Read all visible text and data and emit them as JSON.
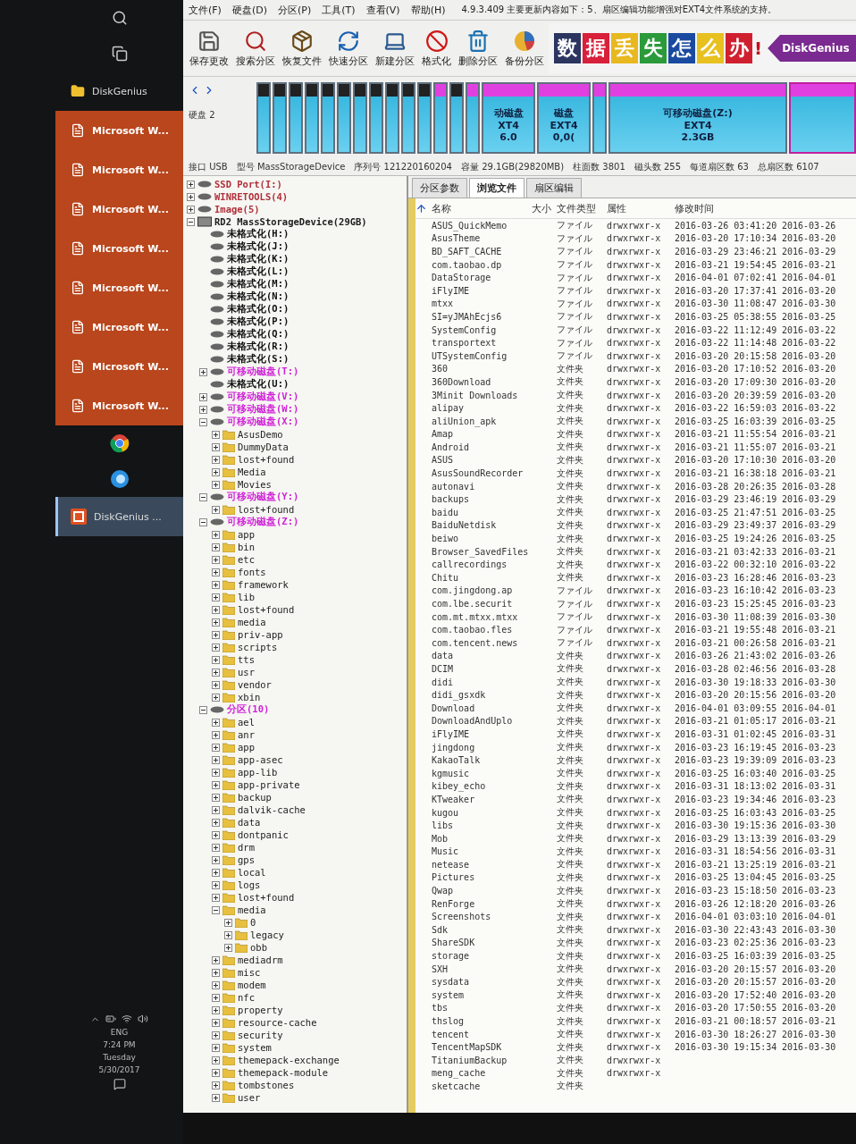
{
  "taskbar": {
    "items": [
      {
        "kind": "search",
        "selected": false
      },
      {
        "kind": "taskview",
        "selected": false
      },
      {
        "kind": "folder",
        "label": "DiskGenius",
        "selected": false,
        "attention": false
      },
      {
        "kind": "word",
        "label": "Microsoft W...",
        "selected": false,
        "attention": true
      },
      {
        "kind": "word",
        "label": "Microsoft W...",
        "selected": false,
        "attention": true
      },
      {
        "kind": "word",
        "label": "Microsoft W...",
        "selected": false,
        "attention": true
      },
      {
        "kind": "word",
        "label": "Microsoft W...",
        "selected": false,
        "attention": true
      },
      {
        "kind": "word",
        "label": "Microsoft W...",
        "selected": false,
        "attention": true
      },
      {
        "kind": "word",
        "label": "Microsoft W...",
        "selected": false,
        "attention": true
      },
      {
        "kind": "word",
        "label": "Microsoft W...",
        "selected": false,
        "attention": true
      },
      {
        "kind": "word",
        "label": "Microsoft W...",
        "selected": false,
        "attention": true
      },
      {
        "kind": "chrome",
        "selected": false,
        "attention": false
      },
      {
        "kind": "browser",
        "selected": false,
        "attention": false
      },
      {
        "kind": "diskgenius",
        "label": "DiskGenius ...",
        "selected": true,
        "attention": false
      }
    ],
    "tray": {
      "language": "ENG",
      "time": "7:24 PM",
      "day": "Tuesday",
      "date": "5/30/2017"
    }
  },
  "menu": {
    "items": [
      "文件(F)",
      "硬盘(D)",
      "分区(P)",
      "工具(T)",
      "查看(V)",
      "帮助(H)"
    ],
    "notice": "4.9.3.409 主要更新内容如下：5、扇区编辑功能增强对EXT4文件系统的支持。"
  },
  "toolbar": [
    {
      "kind": "save",
      "label": "保存更改"
    },
    {
      "kind": "search",
      "label": "搜索分区"
    },
    {
      "kind": "recover",
      "label": "恢复文件"
    },
    {
      "kind": "quick",
      "label": "快速分区"
    },
    {
      "kind": "new",
      "label": "新建分区"
    },
    {
      "kind": "format",
      "label": "格式化"
    },
    {
      "kind": "delete",
      "label": "删除分区"
    },
    {
      "kind": "backup",
      "label": "备份分区"
    }
  ],
  "banner": {
    "tiles": [
      {
        "text": "数",
        "color": "#2b3560"
      },
      {
        "text": "据",
        "color": "#d8203a"
      },
      {
        "text": "丢",
        "color": "#e8b820"
      },
      {
        "text": "失",
        "color": "#2a9a3a"
      },
      {
        "text": "怎",
        "color": "#1a4aa0"
      },
      {
        "text": "么",
        "color": "#e8c020"
      },
      {
        "text": "办",
        "color": "#d02030"
      }
    ],
    "mark": "!",
    "brand": "DiskGenius"
  },
  "disk": {
    "label": "硬盘 2",
    "blocks": [
      {
        "kind": "unformatted",
        "selected": false
      },
      {
        "kind": "unformatted",
        "selected": false
      },
      {
        "kind": "unformatted",
        "selected": false
      },
      {
        "kind": "unformatted",
        "selected": false
      },
      {
        "kind": "unformatted",
        "selected": false
      },
      {
        "kind": "unformatted",
        "selected": false
      },
      {
        "kind": "unformatted",
        "selected": false
      },
      {
        "kind": "unformatted",
        "selected": false
      },
      {
        "kind": "unformatted",
        "selected": false
      },
      {
        "kind": "unformatted",
        "selected": false
      },
      {
        "kind": "unformatted",
        "selected": false
      },
      {
        "kind": "removable",
        "selected": false
      },
      {
        "kind": "unformatted",
        "selected": false
      },
      {
        "kind": "removable",
        "selected": false
      },
      {
        "kind": "removable",
        "selected": false,
        "lines": [
          "动磁盘",
          "XT4",
          "6.0"
        ]
      },
      {
        "kind": "removable",
        "selected": false,
        "lines": [
          "磁盘",
          "EXT4",
          "0,0("
        ]
      },
      {
        "kind": "removable",
        "selected": false
      },
      {
        "kind": "removable",
        "selected": false,
        "lines": [
          "可移动磁盘(Z:)",
          "EXT4",
          "2.3GB"
        ]
      },
      {
        "kind": "removable",
        "selected": true
      }
    ]
  },
  "info": [
    {
      "label": "接口",
      "value": "USB"
    },
    {
      "label": "型号",
      "value": "MassStorageDevice"
    },
    {
      "label": "序列号",
      "value": "121220160204"
    },
    {
      "label": "容量",
      "value": "29.1GB(29820MB)"
    },
    {
      "label": "柱面数",
      "value": "3801"
    },
    {
      "label": "磁头数",
      "value": "255"
    },
    {
      "label": "每道扇区数",
      "value": "63"
    },
    {
      "label": "总扇区数",
      "value": "6107"
    }
  ],
  "tree": [
    {
      "label": "SSD Port(I:)",
      "kind": "partition",
      "color": "#b0303a",
      "expanded": false
    },
    {
      "label": "WINRETOOLS(4)",
      "kind": "partition",
      "color": "#b0303a",
      "expanded": false
    },
    {
      "label": "Image(5)",
      "kind": "partition",
      "color": "#b0303a",
      "expanded": false
    },
    {
      "label": "RD2 MassStorageDevice(29GB)",
      "kind": "disk",
      "color": "#202020",
      "expanded": true,
      "children": [
        {
          "label": "未格式化(H:)",
          "kind": "partition",
          "color": "#101010"
        },
        {
          "label": "未格式化(J:)",
          "kind": "partition",
          "color": "#101010"
        },
        {
          "label": "未格式化(K:)",
          "kind": "partition",
          "color": "#101010"
        },
        {
          "label": "未格式化(L:)",
          "kind": "partition",
          "color": "#101010"
        },
        {
          "label": "未格式化(M:)",
          "kind": "partition",
          "color": "#101010"
        },
        {
          "label": "未格式化(N:)",
          "kind": "partition",
          "color": "#101010"
        },
        {
          "label": "未格式化(O:)",
          "kind": "partition",
          "color": "#101010"
        },
        {
          "label": "未格式化(P:)",
          "kind": "partition",
          "color": "#101010"
        },
        {
          "label": "未格式化(Q:)",
          "kind": "partition",
          "color": "#101010"
        },
        {
          "label": "未格式化(R:)",
          "kind": "partition",
          "color": "#101010"
        },
        {
          "label": "未格式化(S:)",
          "kind": "partition",
          "color": "#101010"
        },
        {
          "label": "可移动磁盘(T:)",
          "kind": "partition",
          "color": "#d020d8",
          "expanded": false
        },
        {
          "label": "未格式化(U:)",
          "kind": "partition",
          "color": "#101010"
        },
        {
          "label": "可移动磁盘(V:)",
          "kind": "partition",
          "color": "#d020d8",
          "expanded": false
        },
        {
          "label": "可移动磁盘(W:)",
          "kind": "partition",
          "color": "#d020d8",
          "expanded": false
        },
        {
          "label": "可移动磁盘(X:)",
          "kind": "partition",
          "color": "#d020d8",
          "expanded": true,
          "children": [
            {
              "label": "AsusDemo",
              "kind": "folder",
              "expanded": false
            },
            {
              "label": "DummyData",
              "kind": "folder",
              "expanded": false
            },
            {
              "label": "lost+found",
              "kind": "folder",
              "expanded": false
            },
            {
              "label": "Media",
              "kind": "folder",
              "expanded": false
            },
            {
              "label": "Movies",
              "kind": "folder",
              "expanded": false
            }
          ]
        },
        {
          "label": "可移动磁盘(Y:)",
          "kind": "partition",
          "color": "#d020d8",
          "expanded": true,
          "children": [
            {
              "label": "lost+found",
              "kind": "folder",
              "expanded": false
            }
          ]
        },
        {
          "label": "可移动磁盘(Z:)",
          "kind": "partition",
          "color": "#d020d8",
          "expanded": true,
          "children": [
            {
              "label": "app",
              "kind": "folder",
              "expanded": false
            },
            {
              "label": "bin",
              "kind": "folder",
              "expanded": false
            },
            {
              "label": "etc",
              "kind": "folder",
              "expanded": false
            },
            {
              "label": "fonts",
              "kind": "folder",
              "expanded": false
            },
            {
              "label": "framework",
              "kind": "folder",
              "expanded": false
            },
            {
              "label": "lib",
              "kind": "folder",
              "expanded": false
            },
            {
              "label": "lost+found",
              "kind": "folder",
              "expanded": false
            },
            {
              "label": "media",
              "kind": "folder",
              "expanded": false
            },
            {
              "label": "priv-app",
              "kind": "folder",
              "expanded": false
            },
            {
              "label": "scripts",
              "kind": "folder",
              "expanded": false
            },
            {
              "label": "tts",
              "kind": "folder",
              "expanded": false
            },
            {
              "label": "usr",
              "kind": "folder",
              "expanded": false
            },
            {
              "label": "vendor",
              "kind": "folder",
              "expanded": false
            },
            {
              "label": "xbin",
              "kind": "folder",
              "expanded": false
            }
          ]
        },
        {
          "label": "分区(10)",
          "kind": "partition",
          "color": "#d020d8",
          "expanded": true,
          "children": [
            {
              "label": "ael",
              "kind": "folder",
              "expanded": false
            },
            {
              "label": "anr",
              "kind": "folder",
              "expanded": false
            },
            {
              "label": "app",
              "kind": "folder",
              "expanded": false
            },
            {
              "label": "app-asec",
              "kind": "folder",
              "expanded": false
            },
            {
              "label": "app-lib",
              "kind": "folder",
              "expanded": false
            },
            {
              "label": "app-private",
              "kind": "folder",
              "expanded": false
            },
            {
              "label": "backup",
              "kind": "folder",
              "expanded": false
            },
            {
              "label": "dalvik-cache",
              "kind": "folder",
              "expanded": false
            },
            {
              "label": "data",
              "kind": "folder",
              "expanded": false
            },
            {
              "label": "dontpanic",
              "kind": "folder",
              "expanded": false
            },
            {
              "label": "drm",
              "kind": "folder",
              "expanded": false
            },
            {
              "label": "gps",
              "kind": "folder",
              "expanded": false
            },
            {
              "label": "local",
              "kind": "folder",
              "expanded": false
            },
            {
              "label": "logs",
              "kind": "folder",
              "expanded": false
            },
            {
              "label": "lost+found",
              "kind": "folder",
              "expanded": false
            },
            {
              "label": "media",
              "kind": "folder",
              "expanded": true,
              "children": [
                {
                  "label": "0",
                  "kind": "folder",
                  "expanded": false
                },
                {
                  "label": "legacy",
                  "kind": "folder",
                  "expanded": false
                },
                {
                  "label": "obb",
                  "kind": "folder",
                  "expanded": false
                }
              ]
            },
            {
              "label": "mediadrm",
              "kind": "folder",
              "expanded": false
            },
            {
              "label": "misc",
              "kind": "folder",
              "expanded": false
            },
            {
              "label": "modem",
              "kind": "folder",
              "expanded": false
            },
            {
              "label": "nfc",
              "kind": "folder",
              "expanded": false
            },
            {
              "label": "property",
              "kind": "folder",
              "expanded": false
            },
            {
              "label": "resource-cache",
              "kind": "folder",
              "expanded": false
            },
            {
              "label": "security",
              "kind": "folder",
              "expanded": false
            },
            {
              "label": "system",
              "kind": "folder",
              "expanded": false
            },
            {
              "label": "themepack-exchange",
              "kind": "folder",
              "expanded": false
            },
            {
              "label": "themepack-module",
              "kind": "folder",
              "expanded": false
            },
            {
              "label": "tombstones",
              "kind": "folder",
              "expanded": false
            },
            {
              "label": "user",
              "kind": "folder",
              "expanded": false
            }
          ]
        }
      ]
    }
  ],
  "tabs": [
    {
      "label": "分区参数",
      "selected": false
    },
    {
      "label": "浏览文件",
      "selected": true
    },
    {
      "label": "扇区编辑",
      "selected": false
    }
  ],
  "files": {
    "header": {
      "name": "名称",
      "size": "大小",
      "type": "文件类型",
      "attributes": "属性",
      "modified": "修改时间"
    },
    "rows": [
      {
        "name": "ASUS_QuickMemo",
        "type": "ファイル",
        "attributes": "drwxrwxr-x",
        "modified": "2016-03-26 03:41:20",
        "column_6": "2016-03-26"
      },
      {
        "name": "AsusTheme",
        "type": "ファイル",
        "attributes": "drwxrwxr-x",
        "modified": "2016-03-20 17:10:34",
        "column_6": "2016-03-20"
      },
      {
        "name": "BD_SAFT_CACHE",
        "type": "ファイル",
        "attributes": "drwxrwxr-x",
        "modified": "2016-03-29 23:46:21",
        "column_6": "2016-03-29"
      },
      {
        "name": "com.taobao.dp",
        "type": "ファイル",
        "attributes": "drwxrwxr-x",
        "modified": "2016-03-21 19:54:45",
        "column_6": "2016-03-21"
      },
      {
        "name": "DataStorage",
        "type": "ファイル",
        "attributes": "drwxrwxr-x",
        "modified": "2016-04-01 07:02:41",
        "column_6": "2016-04-01"
      },
      {
        "name": "iFlyIME",
        "type": "ファイル",
        "attributes": "drwxrwxr-x",
        "modified": "2016-03-20 17:37:41",
        "column_6": "2016-03-20"
      },
      {
        "name": "mtxx",
        "type": "ファイル",
        "attributes": "drwxrwxr-x",
        "modified": "2016-03-30 11:08:47",
        "column_6": "2016-03-30"
      },
      {
        "name": "SI=yJMAhEcjs6",
        "type": "ファイル",
        "attributes": "drwxrwxr-x",
        "modified": "2016-03-25 05:38:55",
        "column_6": "2016-03-25"
      },
      {
        "name": "SystemConfig",
        "type": "ファイル",
        "attributes": "drwxrwxr-x",
        "modified": "2016-03-22 11:12:49",
        "column_6": "2016-03-22"
      },
      {
        "name": "transportext",
        "type": "ファイル",
        "attributes": "drwxrwxr-x",
        "modified": "2016-03-22 11:14:48",
        "column_6": "2016-03-22"
      },
      {
        "name": "UTSystemConfig",
        "type": "ファイル",
        "attributes": "drwxrwxr-x",
        "modified": "2016-03-20 20:15:58",
        "column_6": "2016-03-20"
      },
      {
        "name": "360",
        "type": "文件夹",
        "attributes": "drwxrwxr-x",
        "modified": "2016-03-20 17:10:52",
        "column_6": "2016-03-20"
      },
      {
        "name": "360Download",
        "type": "文件夹",
        "attributes": "drwxrwxr-x",
        "modified": "2016-03-20 17:09:30",
        "column_6": "2016-03-20"
      },
      {
        "name": "3Minit Downloads",
        "type": "文件夹",
        "attributes": "drwxrwxr-x",
        "modified": "2016-03-20 20:39:59",
        "column_6": "2016-03-20"
      },
      {
        "name": "alipay",
        "type": "文件夹",
        "attributes": "drwxrwxr-x",
        "modified": "2016-03-22 16:59:03",
        "column_6": "2016-03-22"
      },
      {
        "name": "aliUnion_apk",
        "type": "文件夹",
        "attributes": "drwxrwxr-x",
        "modified": "2016-03-25 16:03:39",
        "column_6": "2016-03-25"
      },
      {
        "name": "Amap",
        "type": "文件夹",
        "attributes": "drwxrwxr-x",
        "modified": "2016-03-21 11:55:54",
        "column_6": "2016-03-21"
      },
      {
        "name": "Android",
        "type": "文件夹",
        "attributes": "drwxrwxr-x",
        "modified": "2016-03-21 11:55:07",
        "column_6": "2016-03-21"
      },
      {
        "name": "ASUS",
        "type": "文件夹",
        "attributes": "drwxrwxr-x",
        "modified": "2016-03-20 17:10:30",
        "column_6": "2016-03-20"
      },
      {
        "name": "AsusSoundRecorder",
        "type": "文件夹",
        "attributes": "drwxrwxr-x",
        "modified": "2016-03-21 16:38:18",
        "column_6": "2016-03-21"
      },
      {
        "name": "autonavi",
        "type": "文件夹",
        "attributes": "drwxrwxr-x",
        "modified": "2016-03-28 20:26:35",
        "column_6": "2016-03-28"
      },
      {
        "name": "backups",
        "type": "文件夹",
        "attributes": "drwxrwxr-x",
        "modified": "2016-03-29 23:46:19",
        "column_6": "2016-03-29"
      },
      {
        "name": "baidu",
        "type": "文件夹",
        "attributes": "drwxrwxr-x",
        "modified": "2016-03-25 21:47:51",
        "column_6": "2016-03-25"
      },
      {
        "name": "BaiduNetdisk",
        "type": "文件夹",
        "attributes": "drwxrwxr-x",
        "modified": "2016-03-29 23:49:37",
        "column_6": "2016-03-29"
      },
      {
        "name": "beiwo",
        "type": "文件夹",
        "attributes": "drwxrwxr-x",
        "modified": "2016-03-25 19:24:26",
        "column_6": "2016-03-25"
      },
      {
        "name": "Browser_SavedFiles",
        "type": "文件夹",
        "attributes": "drwxrwxr-x",
        "modified": "2016-03-21 03:42:33",
        "column_6": "2016-03-21"
      },
      {
        "name": "callrecordings",
        "type": "文件夹",
        "attributes": "drwxrwxr-x",
        "modified": "2016-03-22 00:32:10",
        "column_6": "2016-03-22"
      },
      {
        "name": "Chitu",
        "type": "文件夹",
        "attributes": "drwxrwxr-x",
        "modified": "2016-03-23 16:28:46",
        "column_6": "2016-03-23"
      },
      {
        "name": "com.jingdong.ap",
        "type": "ファイル",
        "attributes": "drwxrwxr-x",
        "modified": "2016-03-23 16:10:42",
        "column_6": "2016-03-23"
      },
      {
        "name": "com.lbe.securit",
        "type": "ファイル",
        "attributes": "drwxrwxr-x",
        "modified": "2016-03-23 15:25:45",
        "column_6": "2016-03-23"
      },
      {
        "name": "com.mt.mtxx.mtxx",
        "type": "ファイル",
        "attributes": "drwxrwxr-x",
        "modified": "2016-03-30 11:08:39",
        "column_6": "2016-03-30"
      },
      {
        "name": "com.taobao.fles",
        "type": "ファイル",
        "attributes": "drwxrwxr-x",
        "modified": "2016-03-21 19:55:48",
        "column_6": "2016-03-21"
      },
      {
        "name": "com.tencent.news",
        "type": "ファイル",
        "attributes": "drwxrwxr-x",
        "modified": "2016-03-21 00:26:58",
        "column_6": "2016-03-21"
      },
      {
        "name": "data",
        "type": "文件夹",
        "attributes": "drwxrwxr-x",
        "modified": "2016-03-26 21:43:02",
        "column_6": "2016-03-26"
      },
      {
        "name": "DCIM",
        "type": "文件夹",
        "attributes": "drwxrwxr-x",
        "modified": "2016-03-28 02:46:56",
        "column_6": "2016-03-28"
      },
      {
        "name": "didi",
        "type": "文件夹",
        "attributes": "drwxrwxr-x",
        "modified": "2016-03-30 19:18:33",
        "column_6": "2016-03-30"
      },
      {
        "name": "didi_gsxdk",
        "type": "文件夹",
        "attributes": "drwxrwxr-x",
        "modified": "2016-03-20 20:15:56",
        "column_6": "2016-03-20"
      },
      {
        "name": "Download",
        "type": "文件夹",
        "attributes": "drwxrwxr-x",
        "modified": "2016-04-01 03:09:55",
        "column_6": "2016-04-01"
      },
      {
        "name": "DownloadAndUplo",
        "type": "文件夹",
        "attributes": "drwxrwxr-x",
        "modified": "2016-03-21 01:05:17",
        "column_6": "2016-03-21"
      },
      {
        "name": "iFlyIME",
        "type": "文件夹",
        "attributes": "drwxrwxr-x",
        "modified": "2016-03-31 01:02:45",
        "column_6": "2016-03-31"
      },
      {
        "name": "jingdong",
        "type": "文件夹",
        "attributes": "drwxrwxr-x",
        "modified": "2016-03-23 16:19:45",
        "column_6": "2016-03-23"
      },
      {
        "name": "KakaoTalk",
        "type": "文件夹",
        "attributes": "drwxrwxr-x",
        "modified": "2016-03-23 19:39:09",
        "column_6": "2016-03-23"
      },
      {
        "name": "kgmusic",
        "type": "文件夹",
        "attributes": "drwxrwxr-x",
        "modified": "2016-03-25 16:03:40",
        "column_6": "2016-03-25"
      },
      {
        "name": "kibey_echo",
        "type": "文件夹",
        "attributes": "drwxrwxr-x",
        "modified": "2016-03-31 18:13:02",
        "column_6": "2016-03-31"
      },
      {
        "name": "KTweaker",
        "type": "文件夹",
        "attributes": "drwxrwxr-x",
        "modified": "2016-03-23 19:34:46",
        "column_6": "2016-03-23"
      },
      {
        "name": "kugou",
        "type": "文件夹",
        "attributes": "drwxrwxr-x",
        "modified": "2016-03-25 16:03:43",
        "column_6": "2016-03-25"
      },
      {
        "name": "libs",
        "type": "文件夹",
        "attributes": "drwxrwxr-x",
        "modified": "2016-03-30 19:15:36",
        "column_6": "2016-03-30"
      },
      {
        "name": "Mob",
        "type": "文件夹",
        "attributes": "drwxrwxr-x",
        "modified": "2016-03-29 13:13:39",
        "column_6": "2016-03-29"
      },
      {
        "name": "Music",
        "type": "文件夹",
        "attributes": "drwxrwxr-x",
        "modified": "2016-03-31 18:54:56",
        "column_6": "2016-03-31"
      },
      {
        "name": "netease",
        "type": "文件夹",
        "attributes": "drwxrwxr-x",
        "modified": "2016-03-21 13:25:19",
        "column_6": "2016-03-21"
      },
      {
        "name": "Pictures",
        "type": "文件夹",
        "attributes": "drwxrwxr-x",
        "modified": "2016-03-25 13:04:45",
        "column_6": "2016-03-25"
      },
      {
        "name": "Qwap",
        "type": "文件夹",
        "attributes": "drwxrwxr-x",
        "modified": "2016-03-23 15:18:50",
        "column_6": "2016-03-23"
      },
      {
        "name": "RenForge",
        "type": "文件夹",
        "attributes": "drwxrwxr-x",
        "modified": "2016-03-26 12:18:20",
        "column_6": "2016-03-26"
      },
      {
        "name": "Screenshots",
        "type": "文件夹",
        "attributes": "drwxrwxr-x",
        "modified": "2016-04-01 03:03:10",
        "column_6": "2016-04-01"
      },
      {
        "name": "Sdk",
        "type": "文件夹",
        "attributes": "drwxrwxr-x",
        "modified": "2016-03-30 22:43:43",
        "column_6": "2016-03-30"
      },
      {
        "name": "ShareSDK",
        "type": "文件夹",
        "attributes": "drwxrwxr-x",
        "modified": "2016-03-23 02:25:36",
        "column_6": "2016-03-23"
      },
      {
        "name": "storage",
        "type": "文件夹",
        "attributes": "drwxrwxr-x",
        "modified": "2016-03-25 16:03:39",
        "column_6": "2016-03-25"
      },
      {
        "name": "SXH",
        "type": "文件夹",
        "attributes": "drwxrwxr-x",
        "modified": "2016-03-20 20:15:57",
        "column_6": "2016-03-20"
      },
      {
        "name": "sysdata",
        "type": "文件夹",
        "attributes": "drwxrwxr-x",
        "modified": "2016-03-20 20:15:57",
        "column_6": "2016-03-20"
      },
      {
        "name": "system",
        "type": "文件夹",
        "attributes": "drwxrwxr-x",
        "modified": "2016-03-20 17:52:40",
        "column_6": "2016-03-20"
      },
      {
        "name": "tbs",
        "type": "文件夹",
        "attributes": "drwxrwxr-x",
        "modified": "2016-03-20 17:50:55",
        "column_6": "2016-03-20"
      },
      {
        "name": "thslog",
        "type": "文件夹",
        "attributes": "drwxrwxr-x",
        "modified": "2016-03-21 00:18:57",
        "column_6": "2016-03-21"
      },
      {
        "name": "tencent",
        "type": "文件夹",
        "attributes": "drwxrwxr-x",
        "modified": "2016-03-30 18:26:27",
        "column_6": "2016-03-30"
      },
      {
        "name": "TencentMapSDK",
        "type": "文件夹",
        "attributes": "drwxrwxr-x",
        "modified": "2016-03-30 19:15:34",
        "column_6": "2016-03-30"
      },
      {
        "name": "TitaniumBackup",
        "type": "文件夹",
        "attributes": "drwxrwxr-x"
      },
      {
        "name": "meng_cache",
        "type": "文件夹",
        "attributes": "drwxrwxr-x"
      },
      {
        "name": "sketcache",
        "type": "文件夹"
      }
    ]
  }
}
